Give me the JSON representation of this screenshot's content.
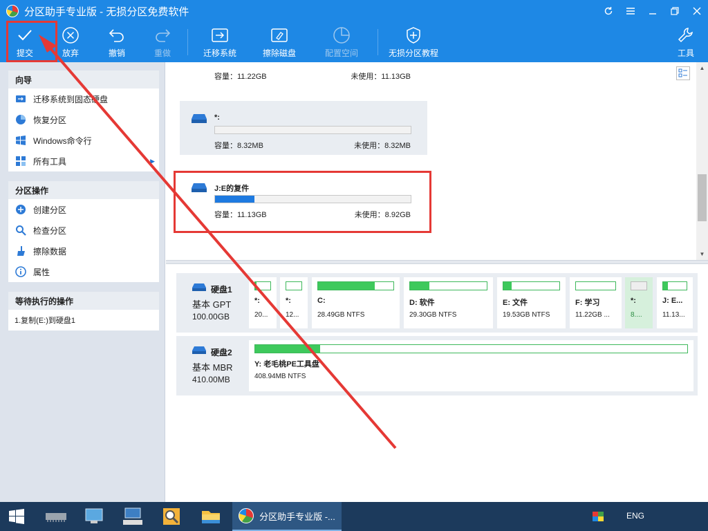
{
  "window": {
    "title": "分区助手专业版 - 无损分区免费软件",
    "controls": [
      "refresh-icon",
      "menu-icon",
      "minimize-icon",
      "restore-icon",
      "close-icon"
    ]
  },
  "toolbar": {
    "submit": "提交",
    "discard": "放弃",
    "undo": "撤销",
    "redo": "重做",
    "migrate": "迁移系统",
    "wipe_disk": "擦除磁盘",
    "allocate": "配置空间",
    "tutorial": "无损分区教程",
    "tools": "工具"
  },
  "sidebar": {
    "wizard": {
      "title": "向导",
      "items": [
        "迁移系统到固态硬盘",
        "恢复分区",
        "Windows命令行",
        "所有工具"
      ]
    },
    "partition_ops": {
      "title": "分区操作",
      "items": [
        "创建分区",
        "检查分区",
        "擦除数据",
        "属性"
      ]
    },
    "pending": {
      "title": "等待执行的操作",
      "items": [
        "1.复制(E:)到硬盘1"
      ]
    }
  },
  "cards": [
    {
      "name": "",
      "capacity": "容量：11.22GB",
      "unused": "未使用：11.13GB",
      "fill": 0.0
    },
    {
      "name": "*:",
      "capacity": "容量：8.32MB",
      "unused": "未使用：8.32MB",
      "fill": 0.0
    },
    {
      "name": "J:E的复件",
      "capacity": "容量：11.13GB",
      "unused": "未使用：8.92GB",
      "fill": 0.2
    }
  ],
  "disks": [
    {
      "name": "硬盘1",
      "type": "基本 GPT",
      "size": "100.00GB",
      "partitions": [
        {
          "name": "*:",
          "info": "20...",
          "fill": 0.1
        },
        {
          "name": "*:",
          "info": "12...",
          "fill": 0.0
        },
        {
          "name": "C:",
          "info": "28.49GB NTFS",
          "fill": 0.75
        },
        {
          "name": "D: 软件",
          "info": "29.30GB NTFS",
          "fill": 0.25
        },
        {
          "name": "E: 文件",
          "info": "19.53GB NTFS",
          "fill": 0.15
        },
        {
          "name": "F: 学习",
          "info": "11.22GB ...",
          "fill": 0.0
        },
        {
          "name": "*:",
          "info": "8....",
          "fill": 0.0
        },
        {
          "name": "J: E...",
          "info": "11.13...",
          "fill": 0.2
        }
      ]
    },
    {
      "name": "硬盘2",
      "type": "基本 MBR",
      "size": "410.00MB",
      "partitions": [
        {
          "name": "Y: 老毛桃PE工具盘",
          "info": "408.94MB NTFS",
          "fill": 0.15
        }
      ]
    }
  ],
  "taskbar": {
    "active_app": "分区助手专业版 -...",
    "tray_lang": "ENG"
  },
  "colors": {
    "accent": "#1e88e5",
    "partition_bar": "#1e7ae0",
    "disk_bar": "#3ec95c",
    "annotation": "#e53935"
  }
}
